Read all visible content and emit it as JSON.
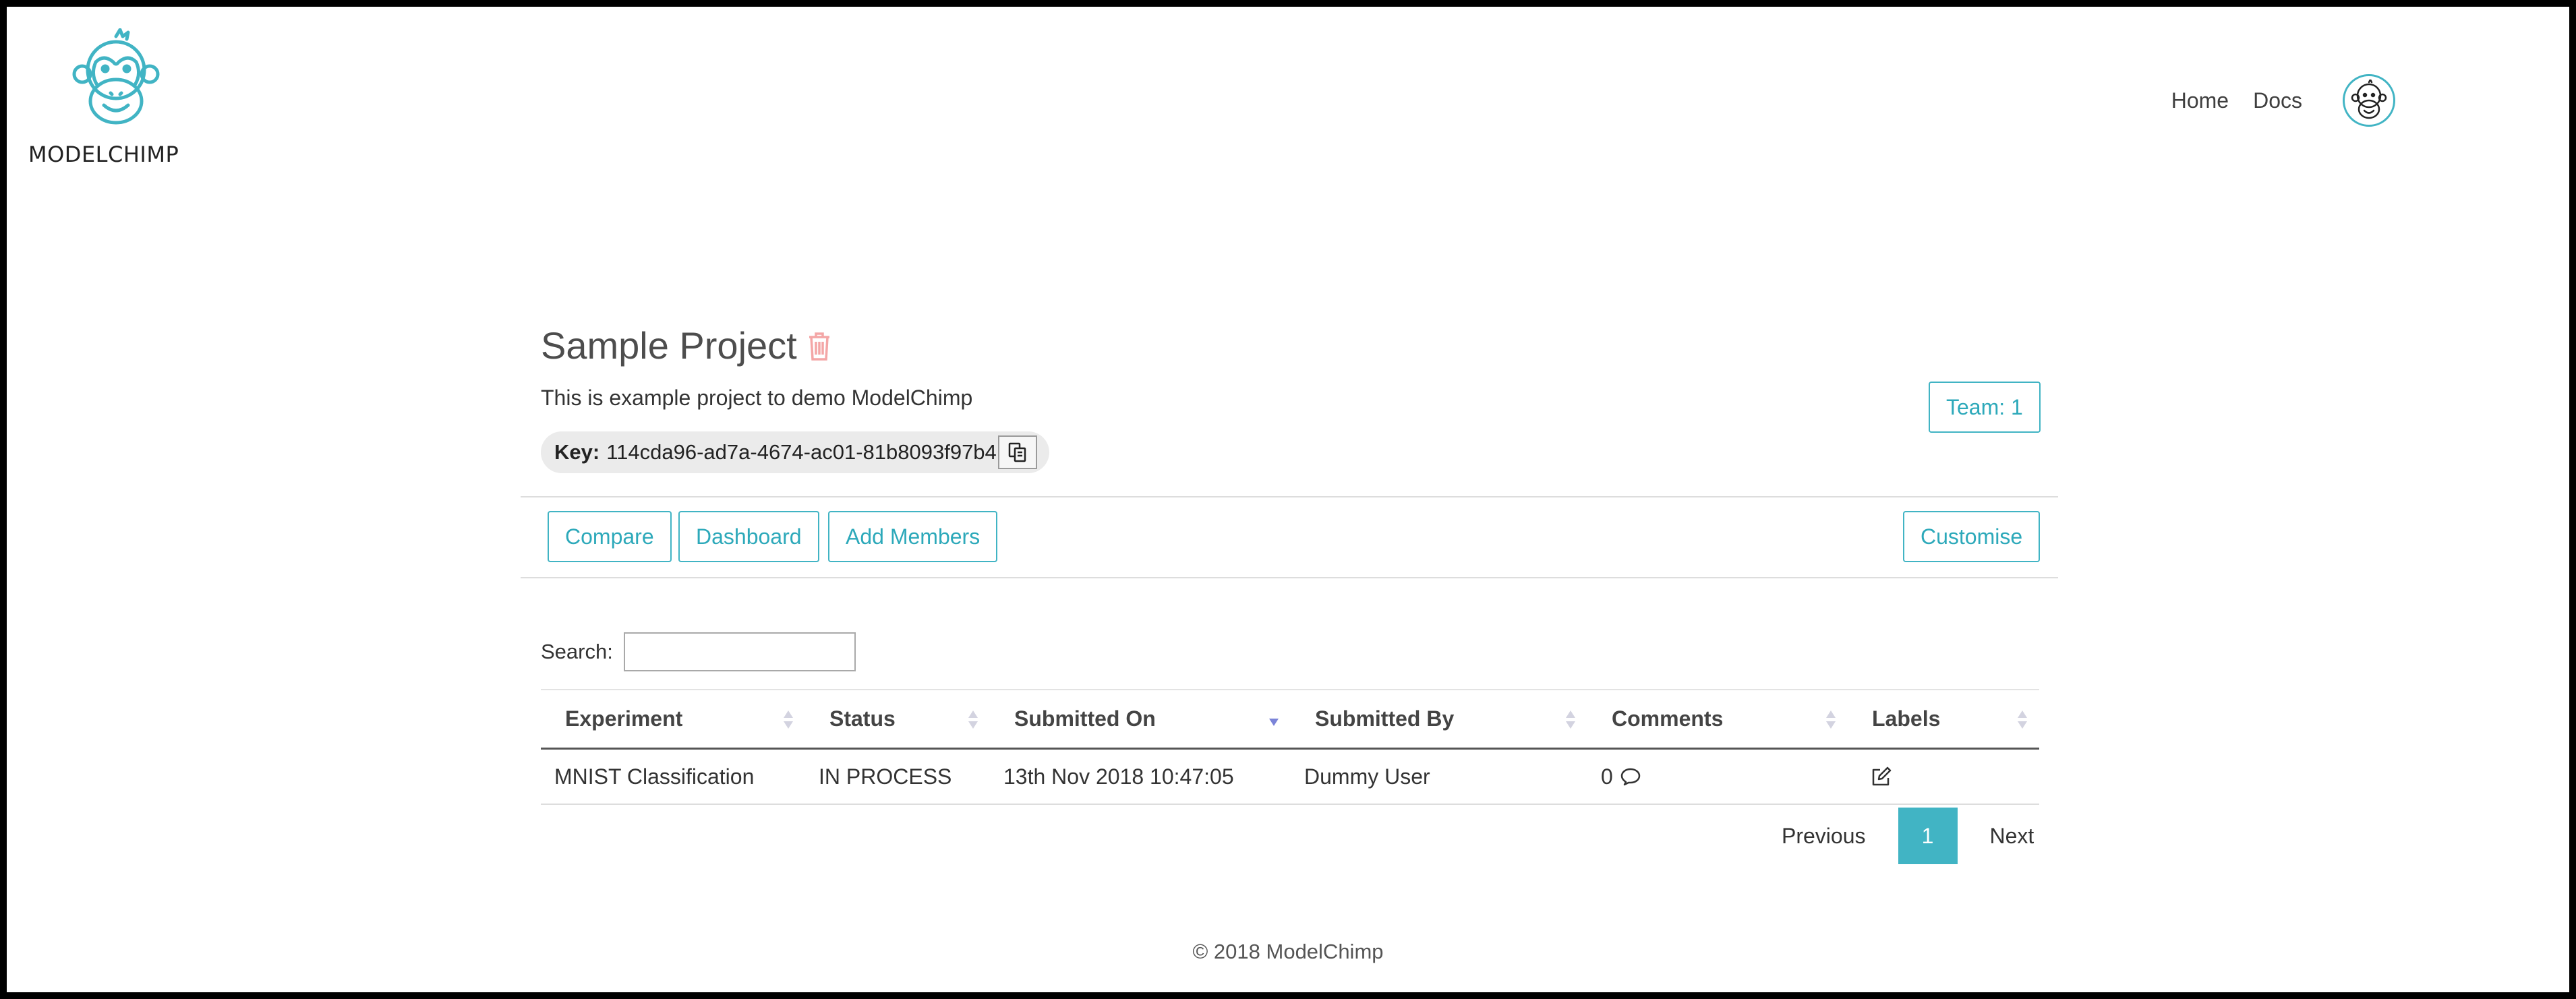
{
  "brand": {
    "name": "MODELCHIMP",
    "logo_icon": "chimp-logo-icon",
    "color": "#41b4c4"
  },
  "nav": {
    "home": "Home",
    "docs": "Docs",
    "avatar_icon": "chimp-avatar-icon"
  },
  "project": {
    "title": "Sample Project",
    "delete_icon": "trash-icon",
    "description": "This is example project to demo ModelChimp",
    "key_label": "Key:",
    "key_value": "114cda96-ad7a-4674-ac01-81b8093f97b4",
    "copy_icon": "copy-icon",
    "team_button": "Team: 1"
  },
  "toolbar": {
    "compare": "Compare",
    "dashboard": "Dashboard",
    "add_members": "Add Members",
    "customise": "Customise"
  },
  "search": {
    "label": "Search:",
    "value": "",
    "placeholder": ""
  },
  "table": {
    "columns": [
      "Experiment",
      "Status",
      "Submitted On",
      "Submitted By",
      "Comments",
      "Labels"
    ],
    "sorted_column": "Submitted On",
    "sort_direction": "descending",
    "rows": [
      {
        "experiment": "MNIST Classification",
        "status": "IN PROCESS",
        "submitted_on": "13th Nov 2018 10:47:05",
        "submitted_by": "Dummy User",
        "comments": "0",
        "comments_icon": "comment-icon",
        "labels_icon": "edit-icon"
      }
    ]
  },
  "pagination": {
    "previous": "Previous",
    "current": "1",
    "next": "Next"
  },
  "footer": {
    "text": "© 2018 ModelChimp"
  },
  "colors": {
    "accent": "#41b4c4",
    "delete": "#f4a6a6",
    "sort_active": "#7b84d8"
  }
}
